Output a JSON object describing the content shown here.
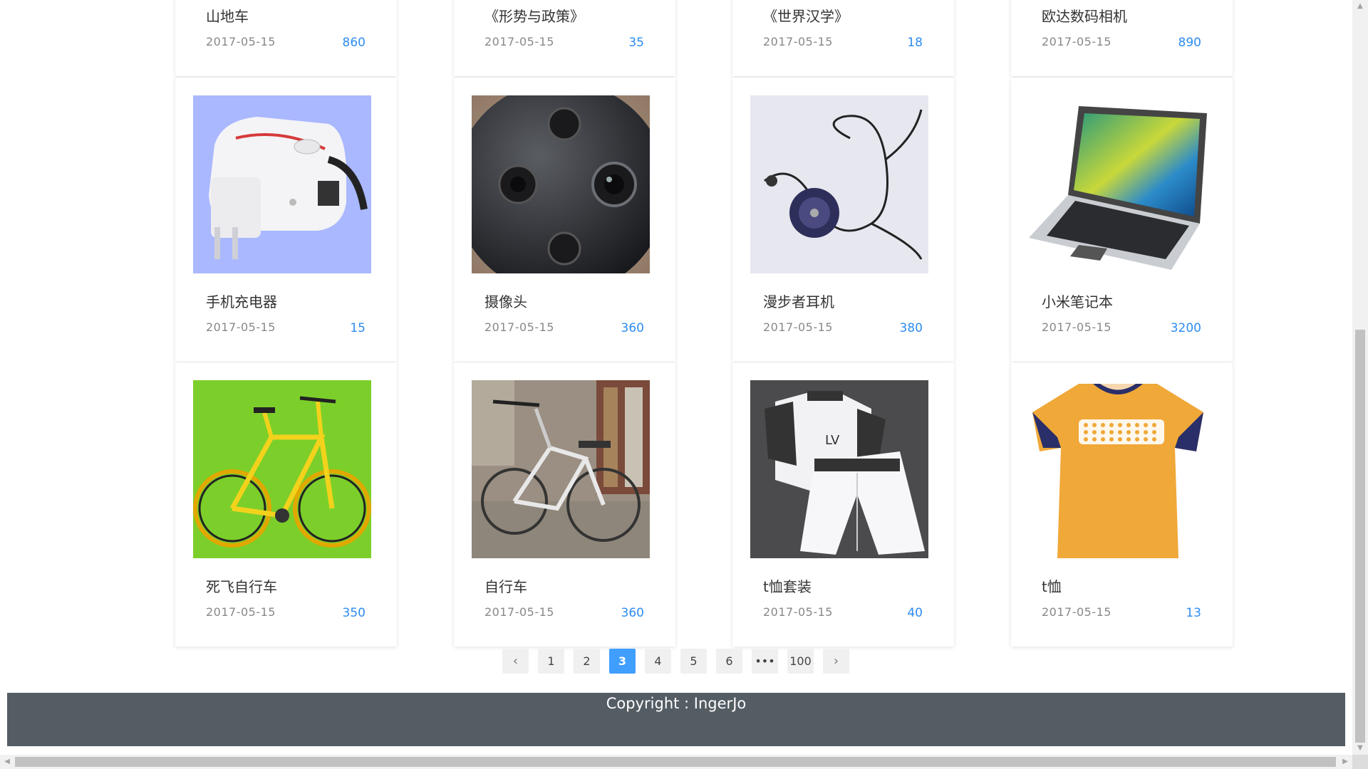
{
  "products": [
    {
      "title": "山地车",
      "date": "2017-05-15",
      "count": "860",
      "image": "mountain-bike"
    },
    {
      "title": "《形势与政策》",
      "date": "2017-05-15",
      "count": "35",
      "image": "book"
    },
    {
      "title": "《世界汉学》",
      "date": "2017-05-15",
      "count": "18",
      "image": "book"
    },
    {
      "title": "欧达数码相机",
      "date": "2017-05-15",
      "count": "890",
      "image": "camera"
    },
    {
      "title": "手机充电器",
      "date": "2017-05-15",
      "count": "15",
      "image": "phone-charger"
    },
    {
      "title": "摄像头",
      "date": "2017-05-15",
      "count": "360",
      "image": "360-camera"
    },
    {
      "title": "漫步者耳机",
      "date": "2017-05-15",
      "count": "380",
      "image": "earphones"
    },
    {
      "title": "小米笔记本",
      "date": "2017-05-15",
      "count": "3200",
      "image": "laptop"
    },
    {
      "title": "死飞自行车",
      "date": "2017-05-15",
      "count": "350",
      "image": "fixed-gear-bike"
    },
    {
      "title": "自行车",
      "date": "2017-05-15",
      "count": "360",
      "image": "bicycle"
    },
    {
      "title": "t恤套装",
      "date": "2017-05-15",
      "count": "40",
      "image": "tshirt-set"
    },
    {
      "title": "t恤",
      "date": "2017-05-15",
      "count": "13",
      "image": "tshirt"
    }
  ],
  "pagination": {
    "prev_icon": "‹",
    "pages": [
      "1",
      "2",
      "3",
      "4",
      "5",
      "6",
      "•••",
      "100"
    ],
    "current": "3",
    "next_icon": "›"
  },
  "footer": {
    "copyright": "Copyright : IngerJo"
  },
  "colors": {
    "accent": "#409eff",
    "count": "#2d8cf0",
    "footer_bg": "#545c64"
  }
}
